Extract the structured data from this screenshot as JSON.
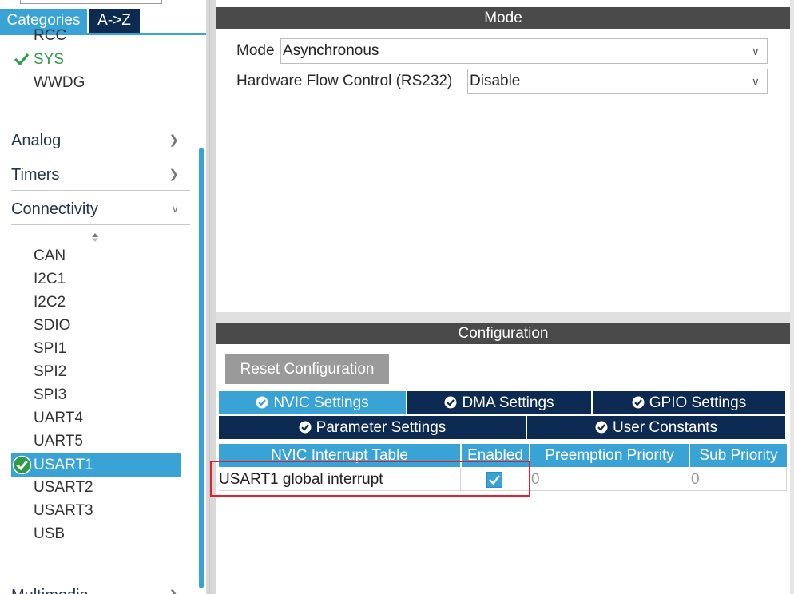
{
  "left": {
    "tabs": [
      "Categories",
      "A->Z"
    ],
    "system_items": [
      "RCC",
      "SYS",
      "WWDG"
    ],
    "categories": [
      {
        "label": "Analog",
        "expanded": false
      },
      {
        "label": "Timers",
        "expanded": false
      },
      {
        "label": "Connectivity",
        "expanded": true
      }
    ],
    "connectivity_items": [
      "CAN",
      "I2C1",
      "I2C2",
      "SDIO",
      "SPI1",
      "SPI2",
      "SPI3",
      "UART4",
      "UART5",
      "USART1",
      "USART2",
      "USART3",
      "USB"
    ],
    "selected_item": "USART1",
    "partial_category": "Multimedia"
  },
  "mode": {
    "header": "Mode",
    "fields": [
      {
        "label": "Mode",
        "value": "Asynchronous"
      },
      {
        "label": "Hardware Flow Control (RS232)",
        "value": "Disable"
      }
    ]
  },
  "config": {
    "header": "Configuration",
    "reset_label": "Reset Configuration",
    "tabs_row1": [
      "NVIC Settings",
      "DMA Settings",
      "GPIO Settings"
    ],
    "tabs_row2": [
      "Parameter Settings",
      "User Constants"
    ],
    "active_tab": "NVIC Settings",
    "table": {
      "headers": [
        "NVIC Interrupt Table",
        "Enabled",
        "Preemption Priority",
        "Sub Priority"
      ],
      "rows": [
        {
          "name": "USART1 global interrupt",
          "enabled": true,
          "preemption": "0",
          "sub": "0"
        }
      ]
    }
  },
  "colors": {
    "accent_blue": "#39a3d6",
    "dark_navy": "#0d2a52",
    "header_grey": "#4a4a4a",
    "ok_green": "#2e9b48",
    "highlight_red": "#d9232d"
  }
}
